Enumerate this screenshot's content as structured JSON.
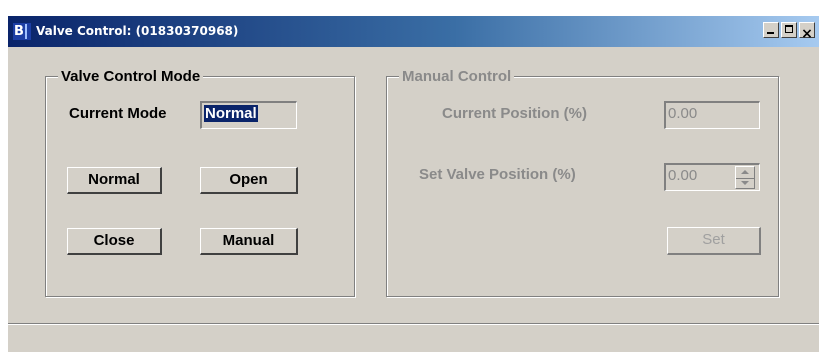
{
  "window": {
    "title": "Valve Control: (01830370968)",
    "icon": "app-logo-icon",
    "icon_text": "B",
    "close_glyph": "×",
    "colors": {
      "titlebar_start": "#0a246a",
      "titlebar_end": "#a6caf0",
      "face": "#d4d0c8",
      "selection": "#0a246a"
    }
  },
  "mode_panel": {
    "title": "Valve Control Mode",
    "current_mode_label": "Current Mode",
    "current_mode_value": "Normal",
    "buttons": {
      "normal": "Normal",
      "open": "Open",
      "close": "Close",
      "manual": "Manual"
    }
  },
  "manual_panel": {
    "title": "Manual Control",
    "current_position_label": "Current Position (%)",
    "current_position_value": "0.00",
    "set_position_label": "Set Valve Position (%)",
    "set_position_value": "0.00",
    "set_button": "Set"
  }
}
